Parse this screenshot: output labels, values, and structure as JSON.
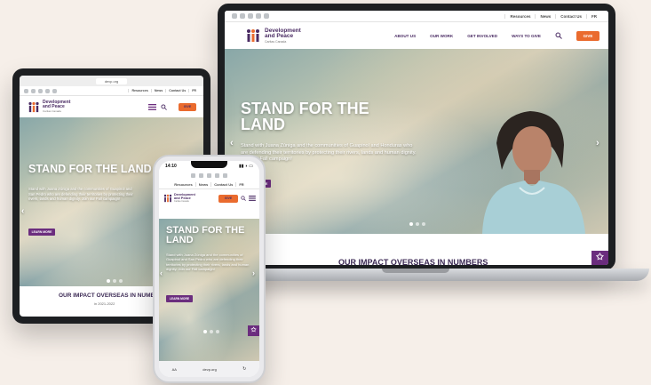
{
  "laptop": {
    "util_links": [
      "Resources",
      "News",
      "Contact Us",
      "FR"
    ],
    "logo": {
      "line1": "Development",
      "line2": "and Peace",
      "sub": "Caritas Canada"
    },
    "menu": [
      "ABOUT US",
      "OUR WORK",
      "GET INVOLVED",
      "WAYS TO GIVE"
    ],
    "give_label": "GIVE",
    "hero_title": "STAND FOR THE LAND",
    "hero_body": "Stand with Juana Zúniga and the communities of Guapinol and Honduras who are defending their territories by protecting their rivers, lands and human dignity. Join our Fall campaign!",
    "learn_more": "LEARN MORE",
    "impact_heading": "OUR IMPACT OVERSEAS IN NUMBERS"
  },
  "tablet": {
    "url": "devp.org",
    "util_links": [
      "Resources",
      "News",
      "Contact Us",
      "FR"
    ],
    "logo": {
      "line1": "Development",
      "line2": "and Peace",
      "sub": "Caritas Canada"
    },
    "give_label": "GIVE",
    "hero_title": "STAND FOR THE LAND",
    "hero_body": "Stand with Juana Zúniga and the communities of Guapinol and San Pedro who are defending their territories by protecting their rivers, lands and human dignity. Join our Fall campaign!",
    "learn_more": "LEARN MORE",
    "impact_heading": "OUR IMPACT OVERSEAS IN NUMBERS",
    "impact_sub": "in 2021-2022"
  },
  "phone": {
    "time": "14:10",
    "util_links": [
      "Resources",
      "News",
      "Contact Us",
      "FR"
    ],
    "logo": {
      "line1": "Development",
      "line2": "and Peace",
      "sub": "Caritas Canada"
    },
    "give_label": "GIVE",
    "hero_title": "STAND FOR THE LAND",
    "hero_body": "Stand with Juana Zúniga and the communities of Guapinol and San Pedro who are defending their territories by protecting their rivers, lands and human dignity. Join our Fall campaign!",
    "learn_more": "LEARN MORE",
    "url": "devp.org",
    "aa_label": "AA"
  },
  "colors": {
    "purple": "#6b2d7e",
    "orange": "#ea6b2e",
    "navy": "#4a2b63"
  }
}
